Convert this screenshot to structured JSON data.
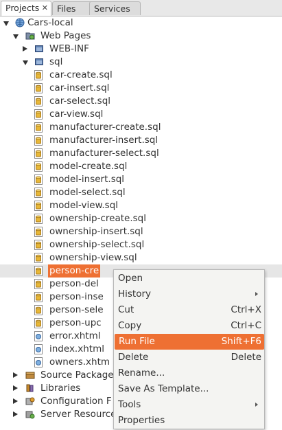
{
  "tabs": [
    {
      "label": "Projects",
      "close": "✕"
    },
    {
      "label": "Files"
    },
    {
      "label": "Services"
    }
  ],
  "tree": [
    {
      "label": "Cars-local",
      "icon": "globe-icon",
      "toggle": "open"
    },
    {
      "label": "Web Pages",
      "icon": "web-folder-icon",
      "toggle": "open"
    },
    {
      "label": "WEB-INF",
      "icon": "folder-icon",
      "toggle": "closed"
    },
    {
      "label": "sql",
      "icon": "folder-icon",
      "toggle": "open"
    },
    {
      "label": "car-create.sql",
      "icon": "sql-file-icon"
    },
    {
      "label": "car-insert.sql",
      "icon": "sql-file-icon"
    },
    {
      "label": "car-select.sql",
      "icon": "sql-file-icon"
    },
    {
      "label": "car-view.sql",
      "icon": "sql-file-icon"
    },
    {
      "label": "manufacturer-create.sql",
      "icon": "sql-file-icon"
    },
    {
      "label": "manufacturer-insert.sql",
      "icon": "sql-file-icon"
    },
    {
      "label": "manufacturer-select.sql",
      "icon": "sql-file-icon"
    },
    {
      "label": "model-create.sql",
      "icon": "sql-file-icon"
    },
    {
      "label": "model-insert.sql",
      "icon": "sql-file-icon"
    },
    {
      "label": "model-select.sql",
      "icon": "sql-file-icon"
    },
    {
      "label": "model-view.sql",
      "icon": "sql-file-icon"
    },
    {
      "label": "ownership-create.sql",
      "icon": "sql-file-icon"
    },
    {
      "label": "ownership-insert.sql",
      "icon": "sql-file-icon"
    },
    {
      "label": "ownership-select.sql",
      "icon": "sql-file-icon"
    },
    {
      "label": "ownership-view.sql",
      "icon": "sql-file-icon"
    },
    {
      "label": "person-cre",
      "icon": "sql-file-icon",
      "selected": true
    },
    {
      "label": "person-del",
      "icon": "sql-file-icon"
    },
    {
      "label": "person-inse",
      "icon": "sql-file-icon"
    },
    {
      "label": "person-sele",
      "icon": "sql-file-icon"
    },
    {
      "label": "person-upc",
      "icon": "sql-file-icon"
    },
    {
      "label": "error.xhtml",
      "icon": "xhtml-file-icon"
    },
    {
      "label": "index.xhtml",
      "icon": "xhtml-file-icon"
    },
    {
      "label": "owners.xhtm",
      "icon": "xhtml-file-icon"
    },
    {
      "label": "Source Package",
      "icon": "package-icon",
      "toggle": "closed"
    },
    {
      "label": "Libraries",
      "icon": "library-icon",
      "toggle": "closed"
    },
    {
      "label": "Configuration F",
      "icon": "config-icon",
      "toggle": "closed"
    },
    {
      "label": "Server Resource",
      "icon": "server-icon",
      "toggle": "closed"
    }
  ],
  "context_menu": [
    {
      "label": "Open"
    },
    {
      "label": "History",
      "submenu": true
    },
    {
      "label": "Cut",
      "shortcut": "Ctrl+X"
    },
    {
      "label": "Copy",
      "shortcut": "Ctrl+C"
    },
    {
      "label": "Run File",
      "shortcut": "Shift+F6",
      "highlighted": true
    },
    {
      "label": "Delete",
      "shortcut": "Delete"
    },
    {
      "label": "Rename..."
    },
    {
      "label": "Save As Template..."
    },
    {
      "label": "Tools",
      "submenu": true
    },
    {
      "label": "Properties"
    }
  ],
  "colors": {
    "accent": "#ee7033",
    "row_highlight": "#e6e6e6",
    "menu_bg": "#f4f4f2"
  }
}
